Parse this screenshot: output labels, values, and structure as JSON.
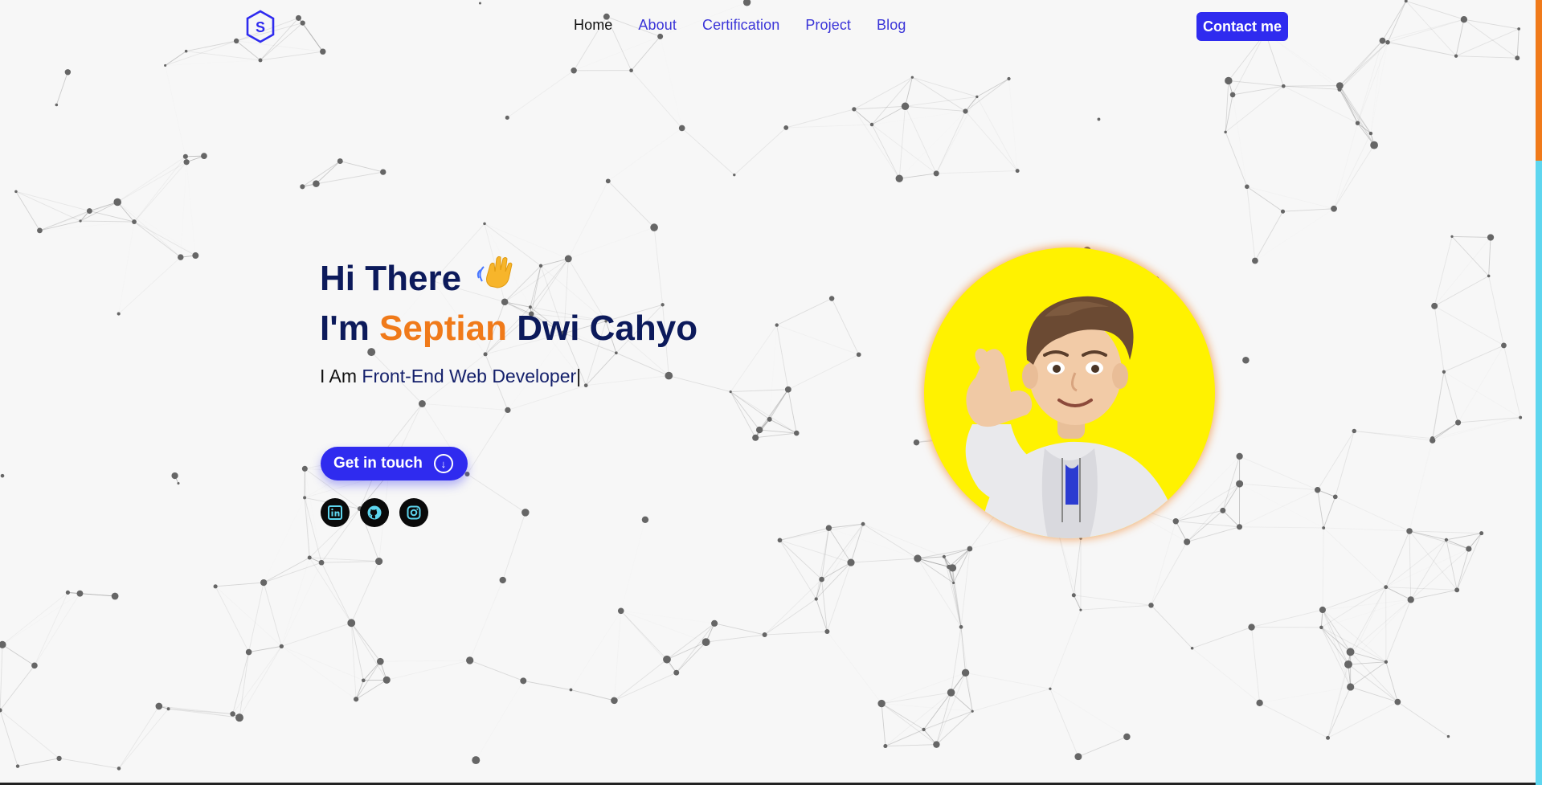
{
  "colors": {
    "primary": "#2f2bef",
    "navy": "#0c1a5b",
    "accent": "#f07a1a",
    "avatar_bg": "#fff200",
    "social_icon": "#5ed6ef"
  },
  "header": {
    "logo_letter": "S",
    "nav": [
      {
        "label": "Home",
        "active": true
      },
      {
        "label": "About",
        "active": false
      },
      {
        "label": "Certification",
        "active": false
      },
      {
        "label": "Project",
        "active": false
      },
      {
        "label": "Blog",
        "active": false
      }
    ],
    "contact_label": "Contact me"
  },
  "hero": {
    "greeting": "Hi There",
    "wave_icon": "waving-hand-icon",
    "intro_prefix": "I'm",
    "first_name": "Septian",
    "last_name": "Dwi Cahyo",
    "role_prefix": "I Am",
    "role_text": "Front-End Web Developer",
    "cursor": "|",
    "cta_label": "Get in touch",
    "cta_icon": "arrow-down-circle-icon",
    "socials": [
      "linkedin-icon",
      "github-icon",
      "instagram-icon"
    ]
  },
  "avatar": {
    "icon": "memoji-avatar"
  }
}
